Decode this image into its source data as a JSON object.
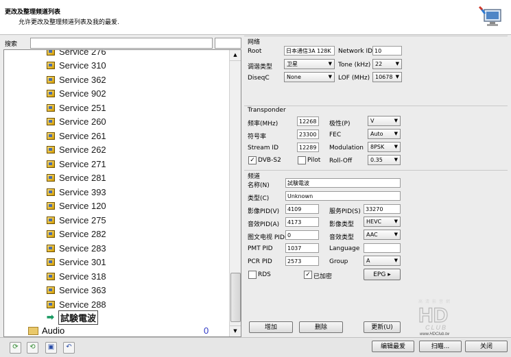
{
  "header": {
    "title": "更改及整理频道列表",
    "subtitle": "允许更改及整理频道列表及我的最爱.",
    "logo_icon": "monitor-cable-icon"
  },
  "search": {
    "label": "搜索",
    "value": "",
    "value2": ""
  },
  "tree": {
    "items": [
      "Service 276",
      "Service 310",
      "Service 362",
      "Service 902",
      "Service 251",
      "Service 260",
      "Service 261",
      "Service 262",
      "Service 271",
      "Service 281",
      "Service 393",
      "Service 120",
      "Service 275",
      "Service 282",
      "Service 283",
      "Service 301",
      "Service 318",
      "Service 363",
      "Service 288"
    ],
    "selected": "試験電波",
    "folder": {
      "label": "Audio",
      "count": "0"
    }
  },
  "network": {
    "title": "网络",
    "root_label": "Root",
    "root_value": "日本通信3A 128K",
    "network_id_label": "Network ID",
    "network_id_value": "10",
    "modulation_type_label": "调谐类型",
    "modulation_type_value": "卫星",
    "tone_label": "Tone (kHz)",
    "tone_value": "22",
    "diseqc_label": "DiseqC",
    "diseqc_value": "None",
    "lof_label": "LOF  (MHz)",
    "lof_value": "10678"
  },
  "transponder": {
    "title": "Transponder",
    "freq_label": "频率(MHz)",
    "freq_value": "12268",
    "polarity_label": "极性(P)",
    "polarity_value": "V",
    "symbol_label": "符号率",
    "symbol_value": "23300",
    "fec_label": "FEC",
    "fec_value": "Auto",
    "stream_label": "Stream ID",
    "stream_value": "12289",
    "modulation_label": "Modulation",
    "modulation_value": "8PSK",
    "dvbs2_label": "DVB-S2",
    "dvbs2_checked": "✓",
    "pilot_label": "Pilot",
    "pilot_checked": "",
    "rolloff_label": "Roll-Off",
    "rolloff_value": "0.35"
  },
  "channel": {
    "title": "频道",
    "name_label": "名称(N)",
    "name_value": "試験電波",
    "type_label": "类型(C)",
    "type_value": "Unknown",
    "vpid_label": "影像PID(V)",
    "vpid_value": "4109",
    "spid_label": "服务PID(S)",
    "spid_value": "33270",
    "apid_label": "音效PID(A)",
    "apid_value": "4173",
    "vtype_label": "影像类型",
    "vtype_value": "HEVC",
    "ttx_label": "图文电视 PID(",
    "ttx_value": "0",
    "atype_label": "音效类型",
    "atype_value": "AAC",
    "pmt_label": "PMT PID",
    "pmt_value": "1037",
    "lang_label": "Language",
    "lang_value": "",
    "pcr_label": "PCR PID",
    "pcr_value": "2573",
    "group_label": "Group",
    "group_value": "A",
    "rds_label": "RDS",
    "rds_checked": "",
    "enc_label": "已加密",
    "enc_checked": "✓",
    "epg_label": "EPG",
    "add_label": "增加",
    "delete_label": "删除",
    "update_label": "更新(U)"
  },
  "bottom": {
    "edit_fav": "编辑最爱",
    "scan": "扫瞄...",
    "close": "关闭"
  },
  "watermark": {
    "line1": "高 清 影 音 網",
    "line2": "HD",
    "line3": "CLUB",
    "line4": "www.HDClub.tw"
  }
}
